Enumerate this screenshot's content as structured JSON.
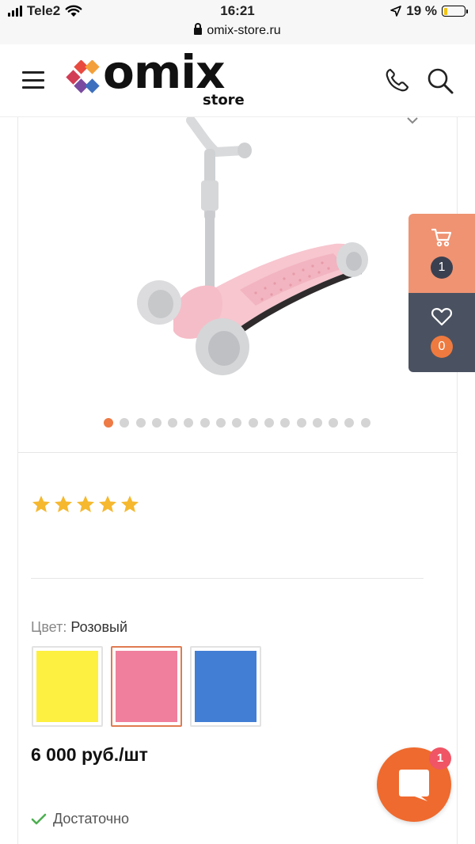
{
  "status_bar": {
    "carrier": "Tele2",
    "time": "16:21",
    "battery": "19 %",
    "battery_level": 0.19,
    "url": "omix-store.ru"
  },
  "header": {
    "logo_text": "omix",
    "logo_sub": "store",
    "menu_icon": "hamburger-icon",
    "phone_icon": "phone-icon",
    "search_icon": "search-icon"
  },
  "product": {
    "gallery": {
      "slide_count": 17,
      "active_slide": 1
    },
    "rating": {
      "stars": 5,
      "max": 5
    },
    "color": {
      "label": "Цвет:",
      "selected": "Розовый",
      "options": [
        {
          "name": "yellow",
          "hex": "#fdf040"
        },
        {
          "name": "pink",
          "hex": "#ef7f9c"
        },
        {
          "name": "blue",
          "hex": "#427ed4"
        }
      ],
      "selected_index": 1
    },
    "price": "6 000 руб./шт",
    "stock": "Достаточно"
  },
  "side_panel": {
    "cart_count": "1",
    "favorites_count": "0"
  },
  "chat": {
    "badge": "1"
  },
  "colors": {
    "accent": "#ef7a45",
    "cart_bg": "#ef9372",
    "fav_bg": "#4a5261",
    "chat": "#ef6a2e",
    "star": "#f5b82e",
    "check": "#4caf50"
  }
}
